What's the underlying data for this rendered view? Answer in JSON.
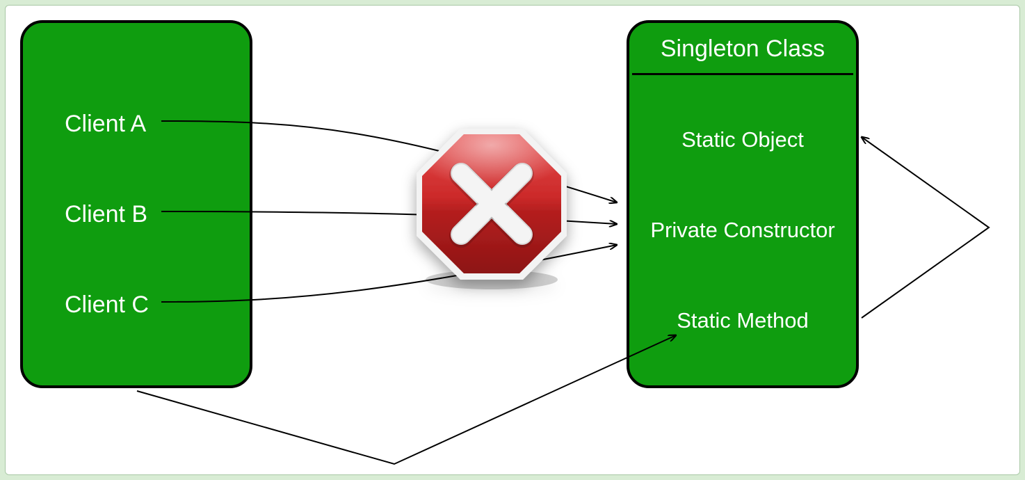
{
  "clients": {
    "a": "Client A",
    "b": "Client B",
    "c": "Client C"
  },
  "singleton": {
    "title": "Singleton Class",
    "members": {
      "staticObject": "Static Object",
      "privateConstructor": "Private Constructor",
      "staticMethod": "Static Method"
    }
  },
  "colors": {
    "boxFill": "#0f9d0f",
    "boxStroke": "#000000",
    "stopRed": "#c62727",
    "stopRedDark": "#981818",
    "frameBg": "#d8ecd4"
  }
}
